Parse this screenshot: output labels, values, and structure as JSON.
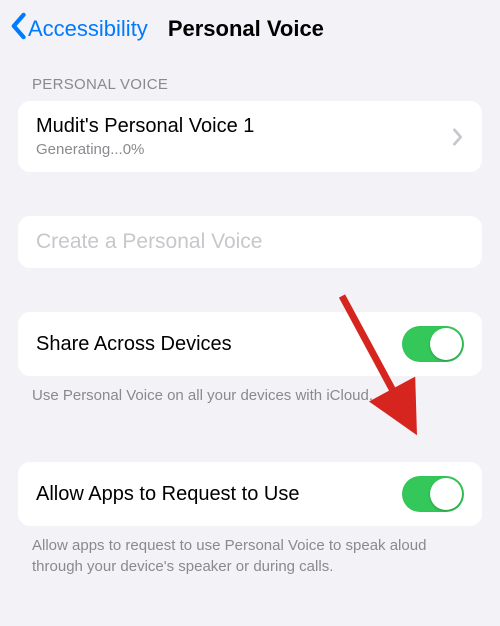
{
  "nav": {
    "back_label": "Accessibility",
    "title": "Personal Voice"
  },
  "sections": {
    "voices": {
      "header": "PERSONAL VOICE",
      "item": {
        "title": "Mudit's Personal Voice 1",
        "subtitle": "Generating...0%"
      },
      "create_label": "Create a Personal Voice"
    },
    "share": {
      "label": "Share Across Devices",
      "on": true,
      "footer": "Use Personal Voice on all your devices with iCloud."
    },
    "allow": {
      "label": "Allow Apps to Request to Use",
      "on": true,
      "footer": "Allow apps to request to use Personal Voice to speak aloud through your device's speaker or during calls."
    }
  },
  "colors": {
    "accent": "#007aff",
    "switch_on": "#34c759",
    "annotation": "#d6241f"
  }
}
